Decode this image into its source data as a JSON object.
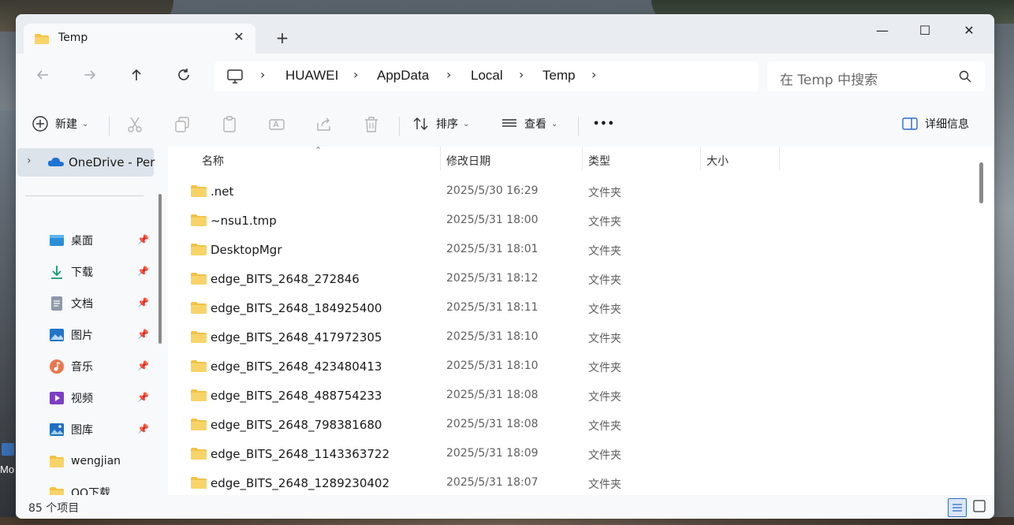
{
  "desktop": {
    "icon_label": "Mo"
  },
  "window": {
    "tab_title": "Temp",
    "new_tab": "+",
    "min": "—",
    "max": "☐",
    "close": "✕"
  },
  "address": {
    "crumbs": [
      "HUAWEI",
      "AppData",
      "Local",
      "Temp"
    ],
    "search_placeholder": "在 Temp 中搜索"
  },
  "toolbar": {
    "new_label": "新建",
    "sort_label": "排序",
    "view_label": "查看",
    "more_label": "•••",
    "details_label": "详细信息"
  },
  "sidebar": {
    "onedrive": "OneDrive - Per",
    "items": [
      {
        "label": "桌面",
        "icon": "desktop-icon",
        "pinned": true
      },
      {
        "label": "下载",
        "icon": "download-icon",
        "pinned": true
      },
      {
        "label": "文档",
        "icon": "document-icon",
        "pinned": true
      },
      {
        "label": "图片",
        "icon": "pictures-icon",
        "pinned": true
      },
      {
        "label": "音乐",
        "icon": "music-icon",
        "pinned": true
      },
      {
        "label": "视频",
        "icon": "video-icon",
        "pinned": true
      },
      {
        "label": "图库",
        "icon": "gallery-icon",
        "pinned": true
      },
      {
        "label": "wengjian",
        "icon": "folder-icon",
        "pinned": false
      },
      {
        "label": "QQ下载",
        "icon": "folder-icon",
        "pinned": false
      }
    ]
  },
  "columns": {
    "name": "名称",
    "date": "修改日期",
    "type": "类型",
    "size": "大小"
  },
  "files": [
    {
      "name": ".net",
      "date": "2025/5/30 16:29",
      "type": "文件夹"
    },
    {
      "name": "~nsu1.tmp",
      "date": "2025/5/31 18:00",
      "type": "文件夹"
    },
    {
      "name": "DesktopMgr",
      "date": "2025/5/31 18:01",
      "type": "文件夹"
    },
    {
      "name": "edge_BITS_2648_272846",
      "date": "2025/5/31 18:12",
      "type": "文件夹"
    },
    {
      "name": "edge_BITS_2648_184925400",
      "date": "2025/5/31 18:11",
      "type": "文件夹"
    },
    {
      "name": "edge_BITS_2648_417972305",
      "date": "2025/5/31 18:10",
      "type": "文件夹"
    },
    {
      "name": "edge_BITS_2648_423480413",
      "date": "2025/5/31 18:10",
      "type": "文件夹"
    },
    {
      "name": "edge_BITS_2648_488754233",
      "date": "2025/5/31 18:08",
      "type": "文件夹"
    },
    {
      "name": "edge_BITS_2648_798381680",
      "date": "2025/5/31 18:08",
      "type": "文件夹"
    },
    {
      "name": "edge_BITS_2648_1143363722",
      "date": "2025/5/31 18:09",
      "type": "文件夹"
    },
    {
      "name": "edge_BITS_2648_1289230402",
      "date": "2025/5/31 18:07",
      "type": "文件夹"
    }
  ],
  "status": {
    "count": "85 个项目"
  },
  "colors": {
    "folder": "#f3c244",
    "accent": "#2e6bc6",
    "selection": "#dde3ea"
  }
}
